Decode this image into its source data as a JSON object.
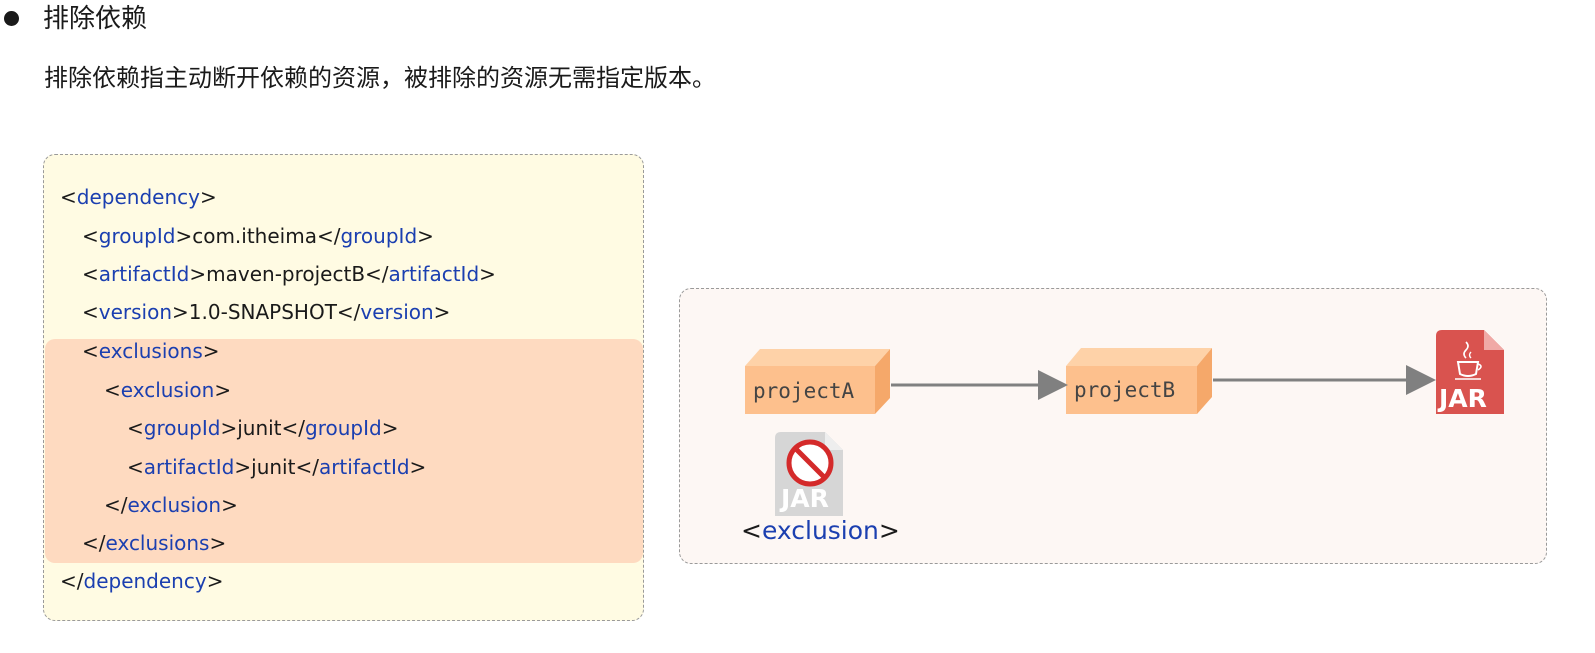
{
  "heading": "排除依赖",
  "description": "排除依赖指主动断开依赖的资源，被排除的资源无需指定版本。",
  "code": {
    "dependency_open": {
      "open": "<",
      "tag": "dependency",
      "close": ">"
    },
    "groupId_line": {
      "open": "<",
      "tag": "groupId",
      "mid": ">com.itheima</",
      "tag2": "groupId",
      "close": ">"
    },
    "artifactId_line": {
      "open": "<",
      "tag": "artifactId",
      "mid": ">maven-projectB</",
      "tag2": "artifactId",
      "close": ">"
    },
    "version_line": {
      "open": "<",
      "tag": "version",
      "mid": ">1.0-SNAPSHOT</",
      "tag2": "version",
      "close": ">"
    },
    "exclusions_open": {
      "open": "<",
      "tag": "exclusions",
      "close": ">"
    },
    "exclusion_open": {
      "open": "<",
      "tag": "exclusion",
      "close": ">"
    },
    "excl_groupId_line": {
      "open": "<",
      "tag": "groupId",
      "mid": ">junit</",
      "tag2": "groupId",
      "close": ">"
    },
    "excl_artifactId_line": {
      "open": "<",
      "tag": "artifactId",
      "mid": ">junit</",
      "tag2": "artifactId",
      "close": ">"
    },
    "exclusion_close": {
      "open": "</",
      "tag": "exclusion",
      "close": ">"
    },
    "exclusions_close": {
      "open": "</",
      "tag": "exclusions",
      "close": ">"
    },
    "dependency_close": {
      "open": "</",
      "tag": "dependency",
      "close": ">"
    }
  },
  "diagram": {
    "node_a": "projectA",
    "node_b": "projectB",
    "jar_label": "JAR",
    "excluded_jar_label": "JAR",
    "excl_label": {
      "open": "<",
      "tag": "exclusion",
      "close": ">"
    }
  },
  "colors": {
    "tag": "#1b3fb0",
    "code_bg": "#fffbe3",
    "highlight_bg": "#fedac0",
    "box_front": "#fdc08d",
    "box_top": "#fed2a8",
    "box_side": "#f5a86a",
    "jar_red": "#d9534f",
    "arrow": "#808080"
  },
  "icons": [
    "bullet-icon",
    "jar-icon",
    "java-cup-icon",
    "prohibited-icon"
  ]
}
